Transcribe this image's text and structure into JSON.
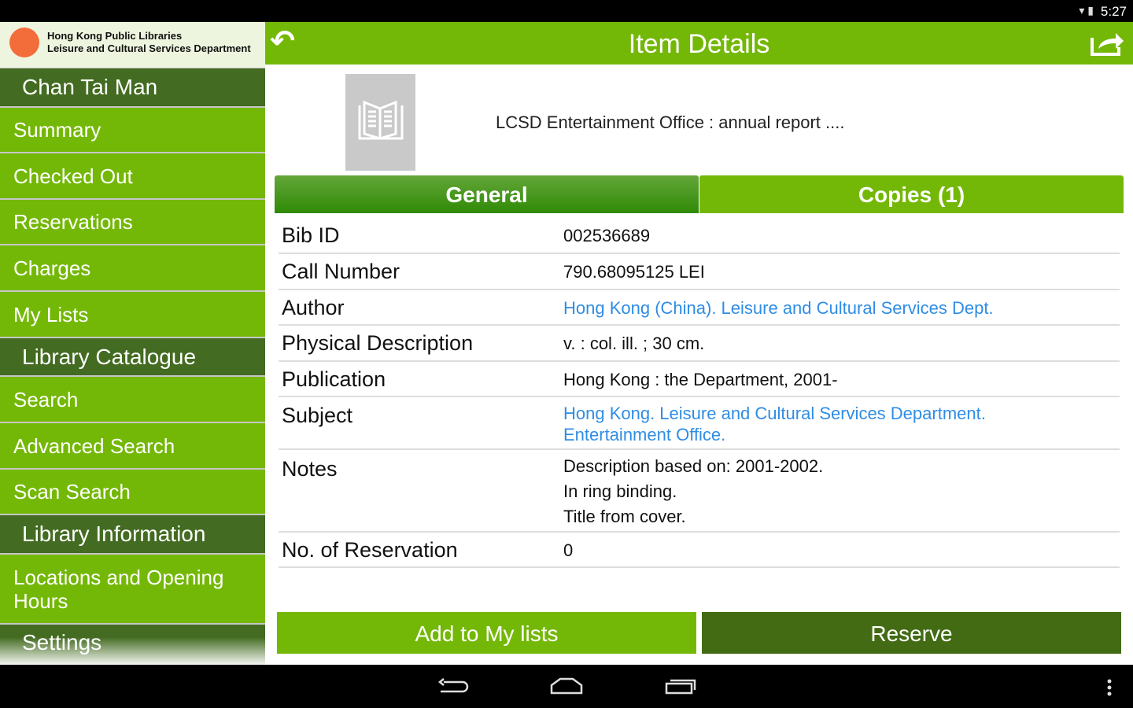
{
  "status": {
    "time": "5:27"
  },
  "logo": {
    "line1": "Hong Kong Public Libraries",
    "line2": "Leisure and Cultural Services Department"
  },
  "sidebar": {
    "items": [
      {
        "label": "Chan Tai Man",
        "type": "header"
      },
      {
        "label": "Summary"
      },
      {
        "label": "Checked Out"
      },
      {
        "label": "Reservations"
      },
      {
        "label": "Charges"
      },
      {
        "label": "My Lists"
      },
      {
        "label": "Library Catalogue",
        "type": "header"
      },
      {
        "label": "Search"
      },
      {
        "label": "Advanced Search"
      },
      {
        "label": "Scan Search"
      },
      {
        "label": "Library Information",
        "type": "header"
      },
      {
        "label": "Locations and Opening Hours"
      },
      {
        "label": "Settings",
        "type": "header"
      }
    ]
  },
  "header": {
    "title": "Item Details"
  },
  "item": {
    "title": "LCSD Entertainment Office : annual report ...."
  },
  "tabs": [
    {
      "label": "General"
    },
    {
      "label": "Copies (1)"
    }
  ],
  "details": [
    {
      "label": "Bib ID",
      "value": "002536689"
    },
    {
      "label": "Call Number",
      "value": "790.68095125 LEI"
    },
    {
      "label": "Author",
      "value": "Hong Kong (China). Leisure and Cultural Services Dept."
    },
    {
      "label": "Physical Description",
      "value": "v. : col. ill. ; 30 cm."
    },
    {
      "label": "Publication",
      "value": "Hong Kong : the Department, 2001-"
    },
    {
      "label": "Subject",
      "value": "Hong Kong. Leisure and Cultural Services Department.",
      "value2": "Entertainment Office."
    },
    {
      "label": "Notes",
      "value": "Description based on: 2001-2002.",
      "value2": "In ring binding.",
      "value3": "Title from cover."
    },
    {
      "label": "No. of Reservation",
      "value": "0"
    }
  ],
  "actions": {
    "add": "Add to My lists",
    "reserve": "Reserve"
  }
}
